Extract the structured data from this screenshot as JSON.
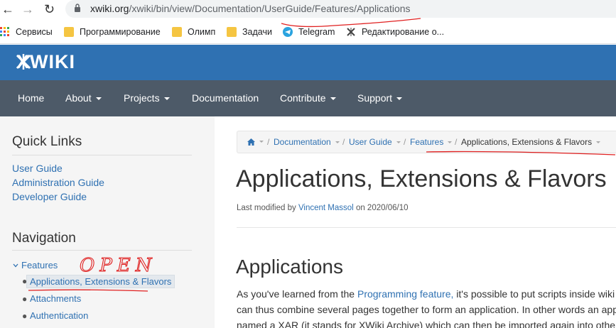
{
  "browser": {
    "url_host": "xwiki.org",
    "url_path": "/xwiki/bin/view/Documentation/UserGuide/Features/Applications",
    "bookmarks": [
      {
        "label": "Сервисы",
        "icon": "apps-grid-icon"
      },
      {
        "label": "Программирование",
        "icon": "folder-icon"
      },
      {
        "label": "Олимп",
        "icon": "folder-icon"
      },
      {
        "label": "Задачи",
        "icon": "folder-icon"
      },
      {
        "label": "Telegram",
        "icon": "telegram-icon"
      },
      {
        "label": "Редактирование о...",
        "icon": "x-icon"
      }
    ]
  },
  "site": {
    "logo": "XWIKI",
    "brand_color": "#2f71b2",
    "menu": [
      {
        "label": "Home"
      },
      {
        "label": "About"
      },
      {
        "label": "Projects"
      },
      {
        "label": "Documentation"
      },
      {
        "label": "Contribute"
      },
      {
        "label": "Support"
      }
    ]
  },
  "sidebar": {
    "quick_links_title": "Quick Links",
    "quick_links": [
      "User Guide",
      "Administration Guide",
      "Developer Guide"
    ],
    "navigation_title": "Navigation",
    "tree": {
      "parent": "Features",
      "children": [
        "Applications, Extensions & Flavors",
        "Attachments",
        "Authentication"
      ]
    }
  },
  "annotation": {
    "handwritten": "OPEN"
  },
  "main": {
    "breadcrumb": [
      "Documentation",
      "User Guide",
      "Features",
      "Applications, Extensions & Flavors"
    ],
    "title": "Applications, Extensions & Flavors",
    "modified_prefix": "Last modified by",
    "modified_author": "Vincent Massol",
    "modified_suffix": "on 2020/06/10",
    "section_title": "Applications",
    "para_line1_a": "As you've learned from the",
    "para_line1_link": "Programming feature,",
    "para_line1_b": "it's possible to put scripts inside wiki",
    "para_line2": "can thus combine several pages together to form an application. In other words an app",
    "para_line3": "named a XAR (it stands for XWiki Archive) which can then be imported again into othe"
  }
}
